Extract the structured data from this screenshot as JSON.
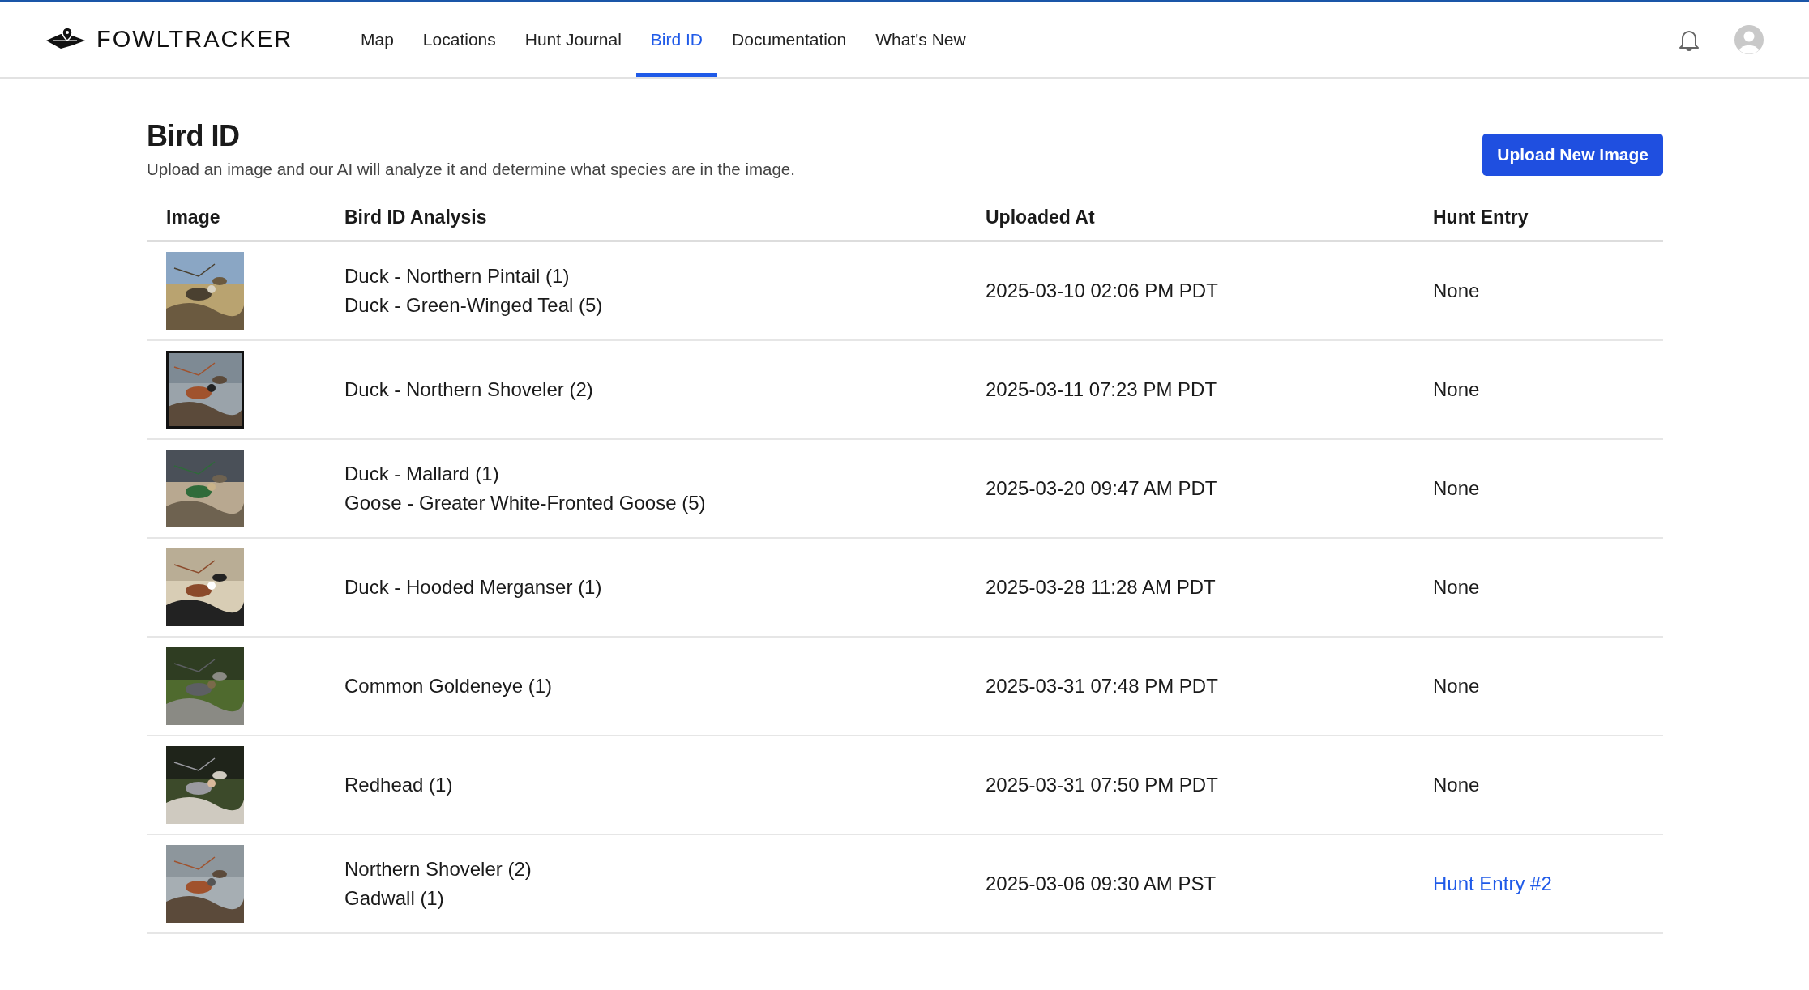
{
  "header": {
    "logo": "FOWLTRACKER",
    "nav": [
      {
        "label": "Map",
        "selected": false
      },
      {
        "label": "Locations",
        "selected": false
      },
      {
        "label": "Hunt Journal",
        "selected": false
      },
      {
        "label": "Bird ID",
        "selected": true
      },
      {
        "label": "Documentation",
        "selected": false
      },
      {
        "label": "What's New",
        "selected": false
      }
    ]
  },
  "page": {
    "title": "Bird ID",
    "subtitle": "Upload an image and our AI will analyze it and determine what species are in the image.",
    "button": "Upload New Image"
  },
  "table": {
    "columns": [
      "Image",
      "Bird ID Analysis",
      "Uploaded At",
      "Hunt Entry"
    ],
    "rows": [
      {
        "image": {
          "kind": "picture"
        },
        "analysis": [
          "Duck - Northern Pintail (1)",
          "Duck - Green-Winged Teal (5)"
        ],
        "uploaded_at": "2025-03-10 02:06 PM PDT",
        "hunt_entry": {
          "text": "None",
          "kind": "text"
        }
      },
      {
        "image": {
          "kind": "picture"
        },
        "analysis": [
          "Duck - Northern Shoveler (2)"
        ],
        "uploaded_at": "2025-03-11 07:23 PM PDT",
        "hunt_entry": {
          "text": "None",
          "kind": "text"
        }
      },
      {
        "image": {
          "kind": "picture"
        },
        "analysis": [
          "Duck - Mallard (1)",
          "Goose - Greater White-Fronted Goose (5)"
        ],
        "uploaded_at": "2025-03-20 09:47 AM PDT",
        "hunt_entry": {
          "text": "None",
          "kind": "text"
        }
      },
      {
        "image": {
          "kind": "picture"
        },
        "analysis": [
          "Duck - Hooded Merganser (1)"
        ],
        "uploaded_at": "2025-03-28 11:28 AM PDT",
        "hunt_entry": {
          "text": "None",
          "kind": "text"
        }
      },
      {
        "image": {
          "kind": "picture"
        },
        "analysis": [
          "Common Goldeneye (1)"
        ],
        "uploaded_at": "2025-03-31 07:48 PM PDT",
        "hunt_entry": {
          "text": "None",
          "kind": "text"
        }
      },
      {
        "image": {
          "kind": "picture"
        },
        "analysis": [
          "Redhead (1)"
        ],
        "uploaded_at": "2025-03-31 07:50 PM PDT",
        "hunt_entry": {
          "text": "None",
          "kind": "text"
        }
      },
      {
        "image": {
          "kind": "picture"
        },
        "analysis": [
          "Northern Shoveler (2)",
          "Gadwall (1)"
        ],
        "uploaded_at": "2025-03-06 09:30 AM PST",
        "hunt_entry": {
          "text": "Hunt Entry #2",
          "kind": "link"
        }
      }
    ]
  }
}
